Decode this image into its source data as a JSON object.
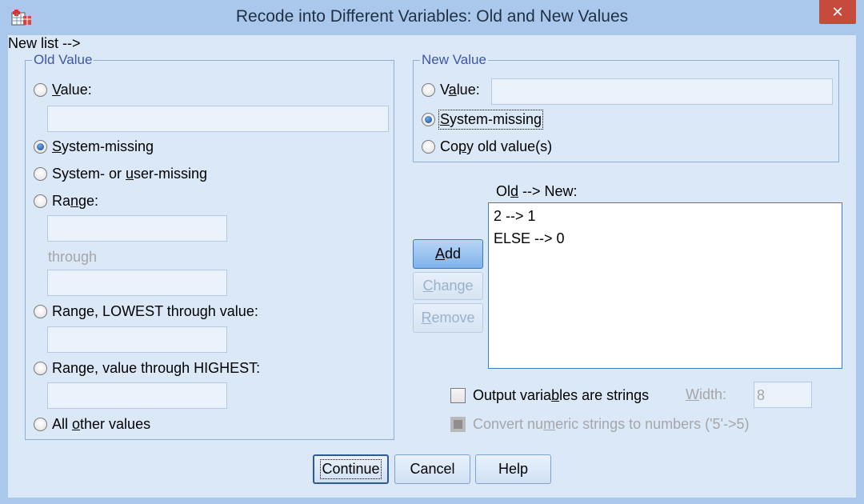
{
  "window": {
    "title": "Recode into Different Variables: Old and New Values",
    "close_glyph": "✕"
  },
  "old_value": {
    "legend": "Old Value",
    "value_label_u": "V",
    "value_label_rest": "alue:",
    "value_input": "",
    "sysmis_label_u": "S",
    "sysmis_label_rest": "ystem-missing",
    "sysuser_pre": "System- or ",
    "sysuser_u": "u",
    "sysuser_post": "ser-missing",
    "range_pre": "Ra",
    "range_u": "n",
    "range_post": "ge:",
    "range_from_input": "",
    "through_label": "through",
    "range_to_input": "",
    "lowest_pre": "Ran",
    "lowest_u": "g",
    "lowest_post": "e, LOWEST through value:",
    "lowest_input": "",
    "highest_pre": "Range",
    "highest_u": ",",
    "highest_post": " value through HIGHEST:",
    "highest_input": "",
    "allother_pre": "All ",
    "allother_u": "o",
    "allother_post": "ther values",
    "selected": "System-missing"
  },
  "new_value": {
    "legend": "New Value",
    "value_pre": "V",
    "value_u": "a",
    "value_post": "lue:",
    "value_input": "",
    "sysmis_u": "S",
    "sysmis_post": "ystem-missing",
    "copy_pre": "Co",
    "copy_u": "p",
    "copy_post": "y old value(s)",
    "selected": "System-missing"
  },
  "mapping": {
    "label_pre": "Ol",
    "label_u": "d",
    "label_post": " --> New:",
    "rows": [
      "2 --> 1",
      "ELSE --> 0"
    ]
  },
  "buttons": {
    "add_u": "A",
    "add_rest": "dd",
    "change_u": "C",
    "change_rest": "hange",
    "remove_u": "R",
    "remove_rest": "emove",
    "continue": "Continue",
    "cancel": "Cancel",
    "help": "Help"
  },
  "options": {
    "strings_pre": "Output varia",
    "strings_u": "b",
    "strings_post": "les are strings",
    "width_u": "W",
    "width_rest": "idth:",
    "width_value": "8",
    "convert_pre": "Convert nu",
    "convert_u": "m",
    "convert_post": "eric strings to numbers ('5'->5)"
  },
  "colors": {
    "titlebar": "#a9c8ec",
    "client": "#dbe8f7",
    "close": "#c74b3c",
    "accent": "#3d78c6"
  }
}
